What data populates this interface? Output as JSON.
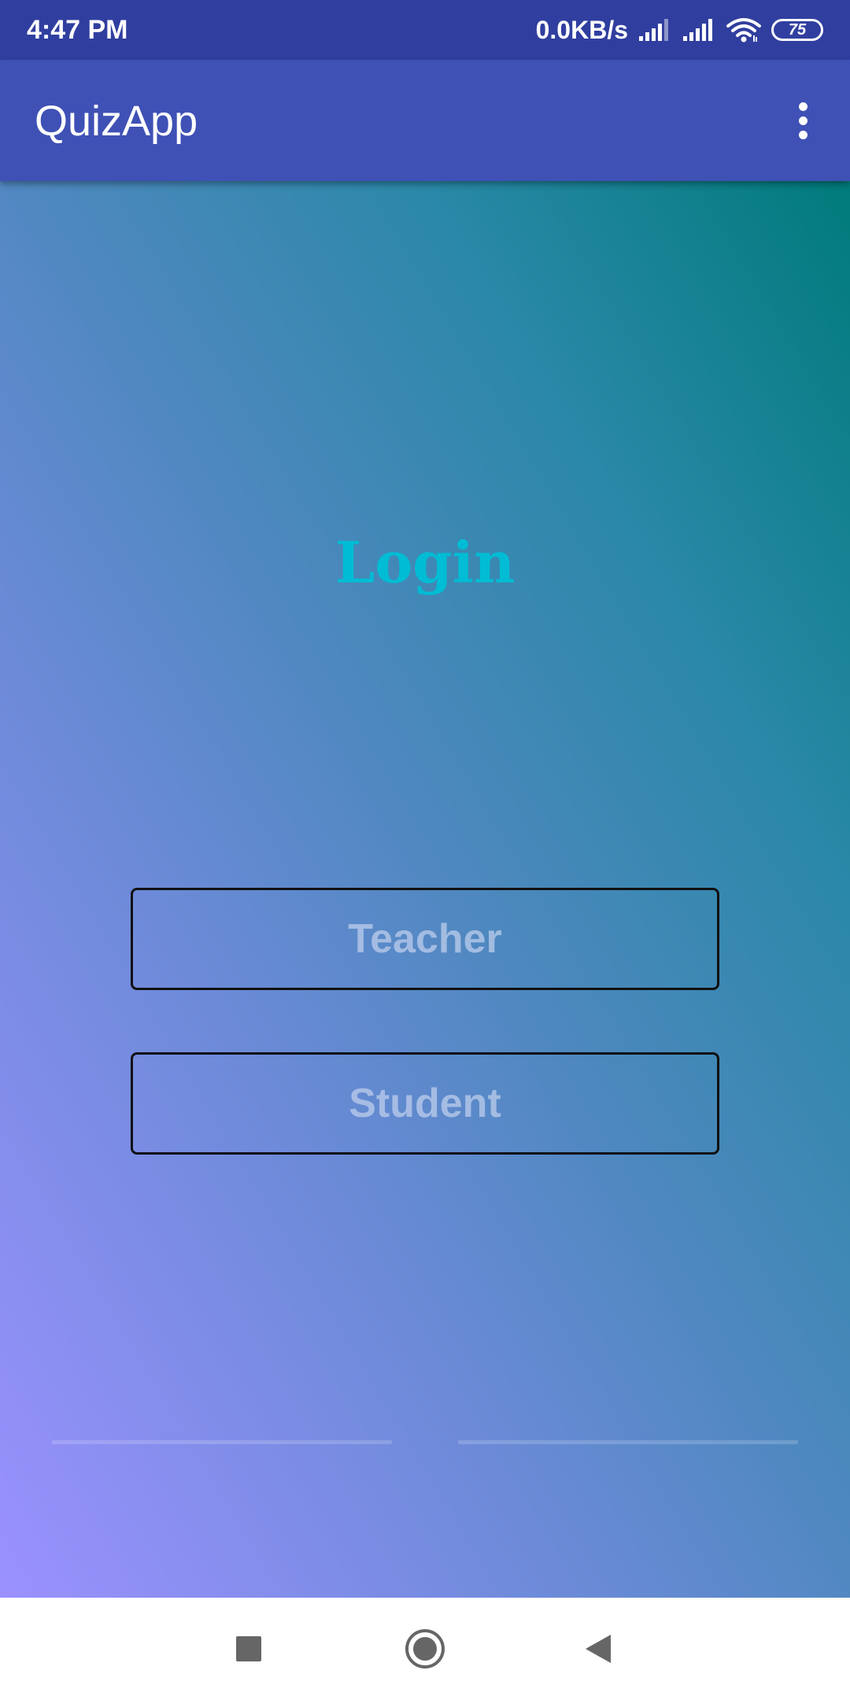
{
  "status_bar": {
    "time": "4:47 PM",
    "net_speed": "0.0KB/s",
    "battery_level": "75",
    "icons": [
      "signal-icon",
      "signal-icon",
      "wifi-icon",
      "battery-icon"
    ]
  },
  "app_bar": {
    "title": "QuizApp",
    "overflow_icon": "more-vert-icon"
  },
  "main": {
    "heading": "Login",
    "buttons": {
      "teacher": "Teacher",
      "student": "Student"
    }
  },
  "nav_bar": {
    "icons": [
      "recents-square-icon",
      "home-circle-icon",
      "back-triangle-icon"
    ]
  },
  "colors": {
    "status_bar": "#303f9f",
    "app_bar": "#3f51b5",
    "heading": "#00bcd4",
    "gradient_start": "#9b91ff",
    "gradient_end": "#007b7b"
  }
}
